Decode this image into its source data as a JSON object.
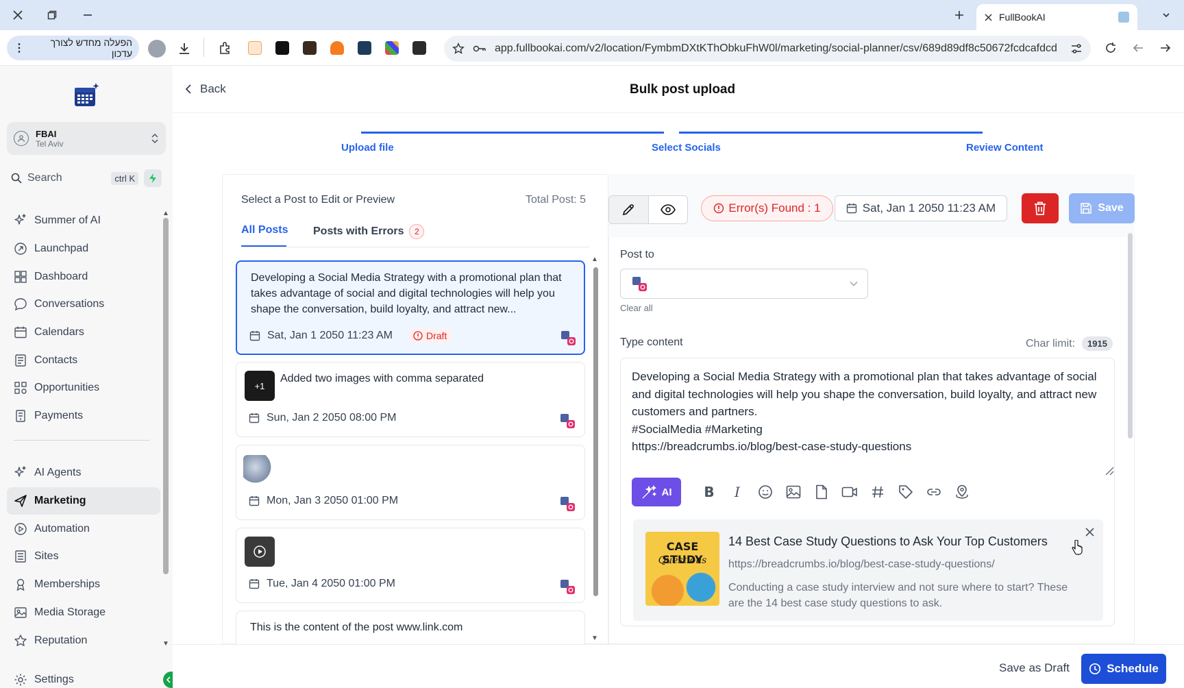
{
  "browser": {
    "tab_title": "FullBookAI",
    "url": "app.fullbookai.com/v2/location/FymbmDXtKThObkuFhW0l/marketing/social-planner/csv/689d89df8c50672fcdcafdcd",
    "hebrew_button": "הפעלה מחדש לצורך עדכון"
  },
  "sidebar": {
    "location_name": "FBAI",
    "location_sub": "Tel Aviv",
    "search_label": "Search",
    "search_shortcut": "ctrl K",
    "items": [
      {
        "label": "Summer of AI",
        "icon": "sparkle-icon"
      },
      {
        "label": "Launchpad",
        "icon": "rocket-icon"
      },
      {
        "label": "Dashboard",
        "icon": "grid-icon"
      },
      {
        "label": "Conversations",
        "icon": "chat-icon"
      },
      {
        "label": "Calendars",
        "icon": "calendar-icon"
      },
      {
        "label": "Contacts",
        "icon": "contacts-icon"
      },
      {
        "label": "Opportunities",
        "icon": "opportunities-icon"
      },
      {
        "label": "Payments",
        "icon": "payments-icon"
      },
      {
        "label": "AI Agents",
        "icon": "sparkle-icon"
      },
      {
        "label": "Marketing",
        "icon": "send-icon"
      },
      {
        "label": "Automation",
        "icon": "automation-icon"
      },
      {
        "label": "Sites",
        "icon": "sites-icon"
      },
      {
        "label": "Memberships",
        "icon": "membership-icon"
      },
      {
        "label": "Media Storage",
        "icon": "image-icon"
      },
      {
        "label": "Reputation",
        "icon": "star-icon"
      }
    ],
    "settings_label": "Settings"
  },
  "header": {
    "back_label": "Back",
    "title": "Bulk post upload"
  },
  "steps": [
    "Upload file",
    "Select Socials",
    "Review Content"
  ],
  "post_list": {
    "heading": "Select a Post to Edit or Preview",
    "total": "Total Post: 5",
    "tab_all": "All Posts",
    "tab_errors": "Posts with Errors",
    "error_count": "2",
    "posts": [
      {
        "text": "Developing a Social Media Strategy with a promotional plan that takes advantage of social and digital technologies will help you shape the conversation, build loyalty, and attract new...",
        "date": "Sat, Jan 1 2050 11:23 AM",
        "badge": "Draft"
      },
      {
        "text": "Added two images with comma separated",
        "date": "Sun, Jan 2 2050 08:00 PM",
        "thumb_label": "+1"
      },
      {
        "text": "",
        "date": "Mon, Jan 3 2050 01:00 PM"
      },
      {
        "text": "",
        "date": "Tue, Jan 4 2050 01:00 PM"
      },
      {
        "text": "This is the content of the post www.link.com",
        "date": ""
      }
    ]
  },
  "editor": {
    "error_pill": "Error(s) Found : 1",
    "date": "Sat, Jan 1 2050 11:23 AM",
    "save_label": "Save",
    "post_to_label": "Post to",
    "clear_all": "Clear all",
    "type_content_label": "Type content",
    "char_limit_label": "Char limit:",
    "char_limit_value": "1915",
    "content": "Developing a Social Media Strategy with a promotional plan that takes advantage of social and digital technologies will help you shape the conversation, build loyalty, and attract new customers and partners.\n#SocialMedia #Marketing\nhttps://breadcrumbs.io/blog/best-case-study-questions",
    "ai_label": "AI",
    "link_preview": {
      "title": "14 Best Case Study Questions to Ask Your Top Customers",
      "url": "https://breadcrumbs.io/blog/best-case-study-questions/",
      "description": "Conducting a case study interview and not sure where to start? These are the 14 best case study questions to ask.",
      "image_text_1": "CASE STUDY",
      "image_text_2": "Questions"
    }
  },
  "footer": {
    "save_draft": "Save as Draft",
    "schedule": "Schedule"
  },
  "colors": {
    "accent": "#2563eb",
    "danger": "#dc2626",
    "ai": "#6d4ee6"
  }
}
